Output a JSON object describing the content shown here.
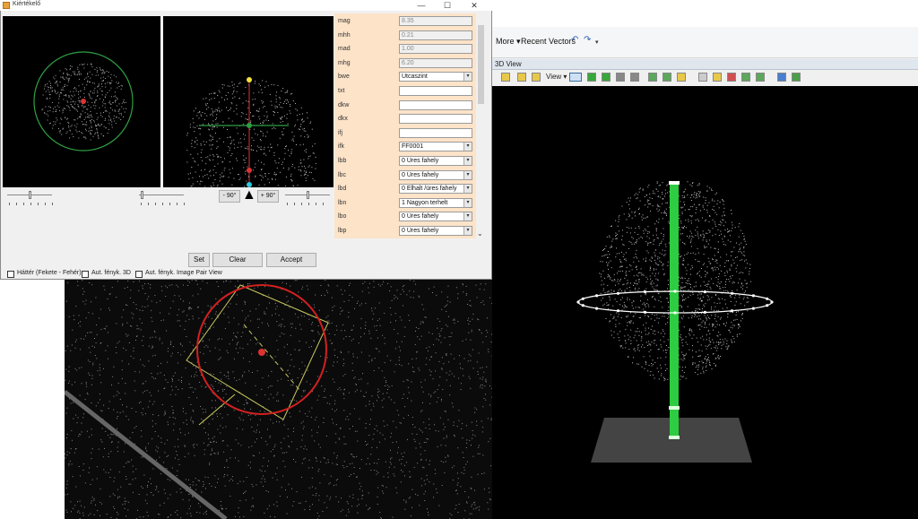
{
  "window": {
    "title": "Kiértékelő"
  },
  "window_controls": {
    "minimize": "—",
    "maximize": "☐",
    "close": "✕"
  },
  "attributes": [
    {
      "label": "mag",
      "value": "8.35",
      "type": "readonly"
    },
    {
      "label": "mhh",
      "value": "0.21",
      "type": "readonly"
    },
    {
      "label": "mad",
      "value": "1.00",
      "type": "readonly"
    },
    {
      "label": "mhg",
      "value": "6.20",
      "type": "readonly"
    },
    {
      "label": "bwe",
      "value": "Utcaszint",
      "type": "select"
    },
    {
      "label": "txt",
      "value": "",
      "type": "text"
    },
    {
      "label": "dkw",
      "value": "",
      "type": "text"
    },
    {
      "label": "dkx",
      "value": "",
      "type": "text"
    },
    {
      "label": "ifj",
      "value": "",
      "type": "text"
    },
    {
      "label": "ifk",
      "value": "FF0001",
      "type": "select"
    },
    {
      "label": "lbb",
      "value": "0 Üres fahely",
      "type": "select"
    },
    {
      "label": "lbc",
      "value": "0 Üres fahely",
      "type": "select"
    },
    {
      "label": "lbd",
      "value": "0 Elhalt /üres fahely",
      "type": "select"
    },
    {
      "label": "lbn",
      "value": "1 Nagyon terhelt",
      "type": "select"
    },
    {
      "label": "lbo",
      "value": "0 Üres fahely",
      "type": "select"
    },
    {
      "label": "lbp",
      "value": "0 Üres fahely",
      "type": "select"
    }
  ],
  "rotation": {
    "minus_label": "- 90°",
    "plus_label": "+ 90°",
    "arrow_glyph": "▲"
  },
  "buttons": {
    "set": "Set",
    "clear": "Clear",
    "accept": "Accept"
  },
  "checkboxes": [
    {
      "label": "Háttér (Fekete - Fehér)",
      "checked": false
    },
    {
      "label": "Aut. fényk. 3D",
      "checked": false
    },
    {
      "label": "Aut. fényk. Image Pair View",
      "checked": false
    }
  ],
  "main_app": {
    "more_label": "More",
    "recent_vectors_label": "Recent Vectors",
    "view_title": "3D View",
    "view_dropdown_label": "View"
  },
  "colors": {
    "attr_bg": "#fde3c8",
    "trunk_green": "#2ecc40",
    "crown_circle": "#2ea043",
    "red_circle": "#d32020"
  },
  "icons": [
    "undo-icon",
    "redo-icon",
    "dropdown-arrow-icon",
    "scroll-down-icon"
  ]
}
